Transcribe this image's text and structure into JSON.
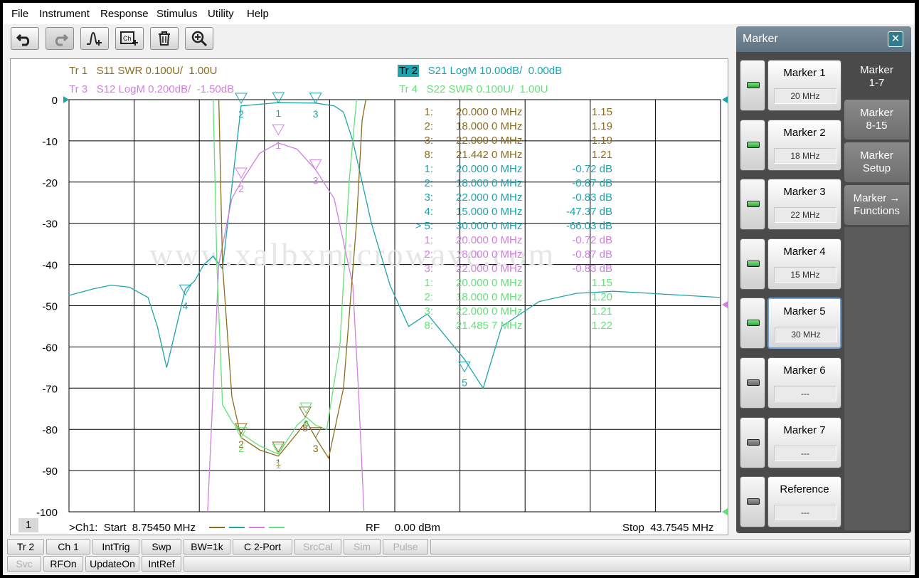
{
  "menu": [
    "File",
    "Instrument",
    "Response",
    "Stimulus",
    "Utility",
    "Help"
  ],
  "toolbar": [
    {
      "name": "undo-button",
      "icon": "undo-icon"
    },
    {
      "name": "redo-button",
      "icon": "redo-icon"
    },
    {
      "name": "add-marker-button",
      "icon": "marker-add-icon"
    },
    {
      "name": "add-channel-button",
      "icon": "channel-add-icon"
    },
    {
      "name": "delete-button",
      "icon": "trash-icon"
    },
    {
      "name": "zoom-button",
      "icon": "zoom-icon"
    }
  ],
  "traces": [
    {
      "id": "Tr 1",
      "label": "S11 SWR 0.100U/  1.00U",
      "color": "#8c6d1f"
    },
    {
      "id": "Tr 2",
      "label": "S21 LogM 10.00dB/  0.00dB",
      "color": "#1fa3ad"
    },
    {
      "id": "Tr 3",
      "label": "S12 LogM 0.200dB/  -1.50dB",
      "color": "#d07fe0"
    },
    {
      "id": "Tr 4",
      "label": "S22 SWR 0.100U/  1.00U",
      "color": "#66e07a"
    }
  ],
  "chart_data": {
    "type": "line",
    "ylim": [
      -100,
      0
    ],
    "xlim": [
      8.7545,
      43.7545
    ],
    "yticks": [
      "0",
      "-10",
      "-20",
      "-30",
      "-40",
      "-50",
      "-60",
      "-70",
      "-80",
      "-90",
      "-100"
    ],
    "series": [
      {
        "name": "S21",
        "color": "#1fa3ad",
        "x": [
          8.75,
          10,
          11,
          12,
          13,
          13.5,
          14,
          15,
          15.5,
          16,
          16.5,
          17,
          18,
          20,
          22,
          23,
          23.5,
          24,
          25,
          26,
          27,
          28,
          30,
          31,
          32,
          34,
          36,
          38,
          40,
          43.75
        ],
        "y": [
          -47.5,
          -46,
          -45,
          -45.5,
          -48,
          -55,
          -65,
          -46,
          -44,
          -40,
          -38,
          -41,
          -1.5,
          -0.72,
          -0.83,
          -1.5,
          -3,
          -10,
          -30,
          -45,
          -55,
          -52,
          -63,
          -70,
          -55,
          -49,
          -47,
          -46.5,
          -47,
          -48
        ]
      },
      {
        "name": "S12",
        "color": "#d07fe0",
        "x": [
          16.2,
          16.5,
          16.8,
          17.5,
          18,
          19,
          20,
          21,
          22,
          23,
          24,
          24.3,
          24.6
        ],
        "y": [
          -100,
          -70,
          -40,
          -24,
          -20,
          -13,
          -10.5,
          -12,
          -17,
          -24,
          -45,
          -70,
          -100
        ]
      },
      {
        "name": "S11",
        "color": "#8c6d1f",
        "x": [
          16.8,
          17,
          17.5,
          18,
          19,
          20,
          21,
          21.5,
          22,
          22.7,
          23.5,
          24.2,
          24.5,
          24.7
        ],
        "y": [
          0,
          -40,
          -72,
          -82,
          -85,
          -86.5,
          -81,
          -78,
          -82,
          -87,
          -70,
          -30,
          -5,
          0
        ]
      },
      {
        "name": "S22",
        "color": "#66e07a",
        "x": [
          16.5,
          16.7,
          17,
          17.5,
          18,
          19,
          20,
          21,
          21.5,
          22,
          22.6,
          23.3,
          23.8,
          24.2
        ],
        "y": [
          0,
          -40,
          -74,
          -78,
          -81,
          -84,
          -86,
          -79,
          -77,
          -79,
          -80,
          -60,
          -20,
          0
        ]
      }
    ],
    "markers": [
      {
        "label": "2",
        "x": 18,
        "y": -0.87,
        "color": "#1fa3ad"
      },
      {
        "label": "1",
        "x": 20,
        "y": -0.72,
        "color": "#1fa3ad"
      },
      {
        "label": "3",
        "x": 22,
        "y": -0.83,
        "color": "#1fa3ad"
      },
      {
        "label": "4",
        "x": 15,
        "y": -47.37,
        "color": "#1fa3ad"
      },
      {
        "label": "5",
        "x": 30,
        "y": -66.03,
        "color": "#1fa3ad"
      },
      {
        "label": "1",
        "x": 20,
        "y": -8.5,
        "color": "#d07fe0"
      },
      {
        "label": "2",
        "x": 18,
        "y": -19,
        "color": "#d07fe0"
      },
      {
        "label": "3",
        "x": 22,
        "y": -17,
        "color": "#d07fe0"
      },
      {
        "label": "2",
        "x": 18,
        "y": -81,
        "color": "#8c6d1f"
      },
      {
        "label": "1",
        "x": 20,
        "y": -85.5,
        "color": "#8c6d1f"
      },
      {
        "label": "3",
        "x": 22,
        "y": -82,
        "color": "#8c6d1f"
      },
      {
        "label": "8",
        "x": 21.442,
        "y": -77,
        "color": "#8c6d1f"
      },
      {
        "label": "2",
        "x": 18,
        "y": -82,
        "color": "#66e07a"
      },
      {
        "label": "1",
        "x": 20,
        "y": -86,
        "color": "#66e07a"
      },
      {
        "label": "8",
        "x": 21.486,
        "y": -76,
        "color": "#66e07a"
      }
    ]
  },
  "marker_table": [
    {
      "id": "1:",
      "freq": "20.000 0 MHz",
      "val": "1.15",
      "color": "#8c6d1f"
    },
    {
      "id": "2:",
      "freq": "18.000 0 MHz",
      "val": "1.19",
      "color": "#8c6d1f"
    },
    {
      "id": "3:",
      "freq": "22.000 0 MHz",
      "val": "1.19",
      "color": "#8c6d1f"
    },
    {
      "id": "8:",
      "freq": "21.442 0 MHz",
      "val": "1.21",
      "color": "#8c6d1f"
    },
    {
      "id": "1:",
      "freq": "20.000 0 MHz",
      "val": "-0.72 dB",
      "color": "#1fa3ad"
    },
    {
      "id": "2:",
      "freq": "18.000 0 MHz",
      "val": "-0.87 dB",
      "color": "#1fa3ad"
    },
    {
      "id": "3:",
      "freq": "22.000 0 MHz",
      "val": "-0.83 dB",
      "color": "#1fa3ad"
    },
    {
      "id": "4:",
      "freq": "15.000 0 MHz",
      "val": "-47.37 dB",
      "color": "#1fa3ad"
    },
    {
      "id": "> 5:",
      "freq": "30.000 0 MHz",
      "val": "-66.03 dB",
      "color": "#1fa3ad"
    },
    {
      "id": "1:",
      "freq": "20.000 0 MHz",
      "val": "-0.72 dB",
      "color": "#d07fe0"
    },
    {
      "id": "2:",
      "freq": "18.000 0 MHz",
      "val": "-0.87 dB",
      "color": "#d07fe0"
    },
    {
      "id": "3:",
      "freq": "22.000 0 MHz",
      "val": "-0.83 dB",
      "color": "#d07fe0"
    },
    {
      "id": "1:",
      "freq": "20.000 0 MHz",
      "val": "1.15",
      "color": "#66e07a"
    },
    {
      "id": "2:",
      "freq": "18.000 0 MHz",
      "val": "1.20",
      "color": "#66e07a"
    },
    {
      "id": "3:",
      "freq": "22.000 0 MHz",
      "val": "1.21",
      "color": "#66e07a"
    },
    {
      "id": "8:",
      "freq": "21.485 7 MHz",
      "val": "1.22",
      "color": "#66e07a"
    }
  ],
  "watermark": "www.xalbxmicrowave.com",
  "footer": {
    "start": ">Ch1:  Start  8.75450 MHz",
    "rf": "RF     0.00 dBm",
    "stop": "Stop  43.7545 MHz"
  },
  "window_number": "1",
  "status_row1": [
    {
      "label": "Tr 2",
      "dim": false
    },
    {
      "label": "Ch 1",
      "dim": false
    },
    {
      "label": "IntTrig",
      "dim": false
    },
    {
      "label": "Swp",
      "dim": false
    },
    {
      "label": "BW=1k",
      "dim": false
    },
    {
      "label": "C  2-Port",
      "dim": false
    },
    {
      "label": "SrcCal",
      "dim": true
    },
    {
      "label": "Sim",
      "dim": true
    },
    {
      "label": "Pulse",
      "dim": true
    }
  ],
  "status_row2": [
    {
      "label": "Svc",
      "dim": true
    },
    {
      "label": "RFOn",
      "dim": false
    },
    {
      "label": "UpdateOn",
      "dim": false
    },
    {
      "label": "IntRef",
      "dim": false
    }
  ],
  "marker_panel": {
    "title": "Marker",
    "markers": [
      {
        "label": "Marker 1",
        "value": "20 MHz",
        "on": true
      },
      {
        "label": "Marker 2",
        "value": "18 MHz",
        "on": true
      },
      {
        "label": "Marker 3",
        "value": "22 MHz",
        "on": true
      },
      {
        "label": "Marker 4",
        "value": "15 MHz",
        "on": true
      },
      {
        "label": "Marker 5",
        "value": "30 MHz",
        "on": true,
        "active": true
      },
      {
        "label": "Marker 6",
        "value": "---",
        "on": false
      },
      {
        "label": "Marker 7",
        "value": "---",
        "on": false
      },
      {
        "label": "Reference",
        "value": "---",
        "on": false
      }
    ],
    "tabs": [
      {
        "label": "Marker\n1-7",
        "active": true
      },
      {
        "label": "Marker\n8-15",
        "active": false
      },
      {
        "label": "Marker\nSetup",
        "active": false
      },
      {
        "label": "Marker →\nFunctions",
        "active": false
      }
    ]
  }
}
